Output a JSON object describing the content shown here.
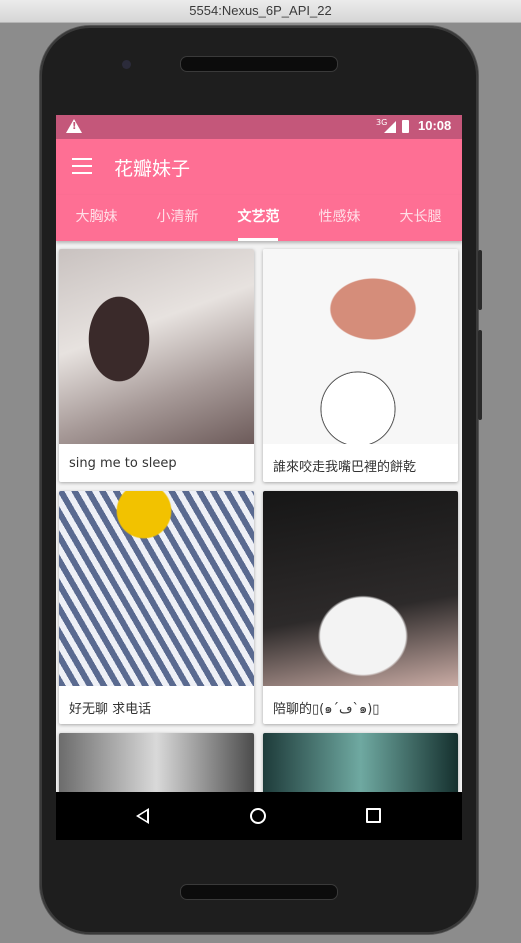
{
  "window": {
    "title": "5554:Nexus_6P_API_22"
  },
  "statusbar": {
    "network": "3G",
    "time": "10:08",
    "warning_mark": "!"
  },
  "toolbar": {
    "title": "花瓣妹子",
    "menu_icon": "hamburger-menu-icon"
  },
  "tabs": [
    {
      "label": "大胸妹",
      "active": false
    },
    {
      "label": "小清新",
      "active": false
    },
    {
      "label": "文艺范",
      "active": true
    },
    {
      "label": "性感妹",
      "active": false
    },
    {
      "label": "大长腿",
      "active": false
    }
  ],
  "cards": [
    {
      "caption": "sing me to sleep"
    },
    {
      "caption": "誰來咬走我嘴巴裡的餅乾"
    },
    {
      "caption": "好无聊 求电话"
    },
    {
      "caption": "陪聊的▯(๑´ڡ`๑)▯"
    },
    {
      "caption": ""
    },
    {
      "caption": ""
    }
  ],
  "colors": {
    "primary": "#fe6f94",
    "status": "#c4577a"
  },
  "navigation": {
    "back_icon": "back-icon",
    "home_icon": "home-icon",
    "recent_icon": "recent-apps-icon"
  }
}
